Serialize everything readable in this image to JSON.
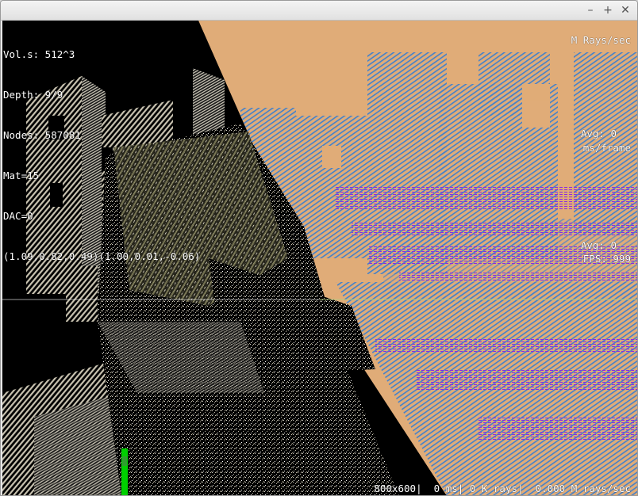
{
  "window": {
    "title": "",
    "controls": {
      "minimize_icon": "minimize-icon",
      "maximize_icon": "maximize-icon",
      "close_icon": "close-icon",
      "minimize_glyph": "–",
      "maximize_glyph": "+",
      "close_glyph": "✕"
    }
  },
  "hud": {
    "stats": [
      "Vol.s: 512^3",
      "Depth: 9/9",
      "Nodes: 587081",
      "Mat=15",
      "DAC=0",
      "(1.09,0.82,0.49)(1.00,0.01,-0.06)"
    ],
    "rays_label": "M Rays/sec",
    "frame_avg": "Avg: 0",
    "frame_unit": "ms/frame",
    "fps_avg": "Avg: 0",
    "fps": "FPS: 999",
    "status_bar": "800x600|  0 ms| 0 K rays|  0.000 M rays/sec"
  },
  "colors": {
    "sky": "#e0ac78",
    "background": "#000000",
    "stone": "#c8c2b0",
    "foliage": "#8a8760",
    "blue_voxels": "#3a7fd0",
    "purple_voxels": "#8a2be2",
    "green_bar": "#00d000"
  }
}
